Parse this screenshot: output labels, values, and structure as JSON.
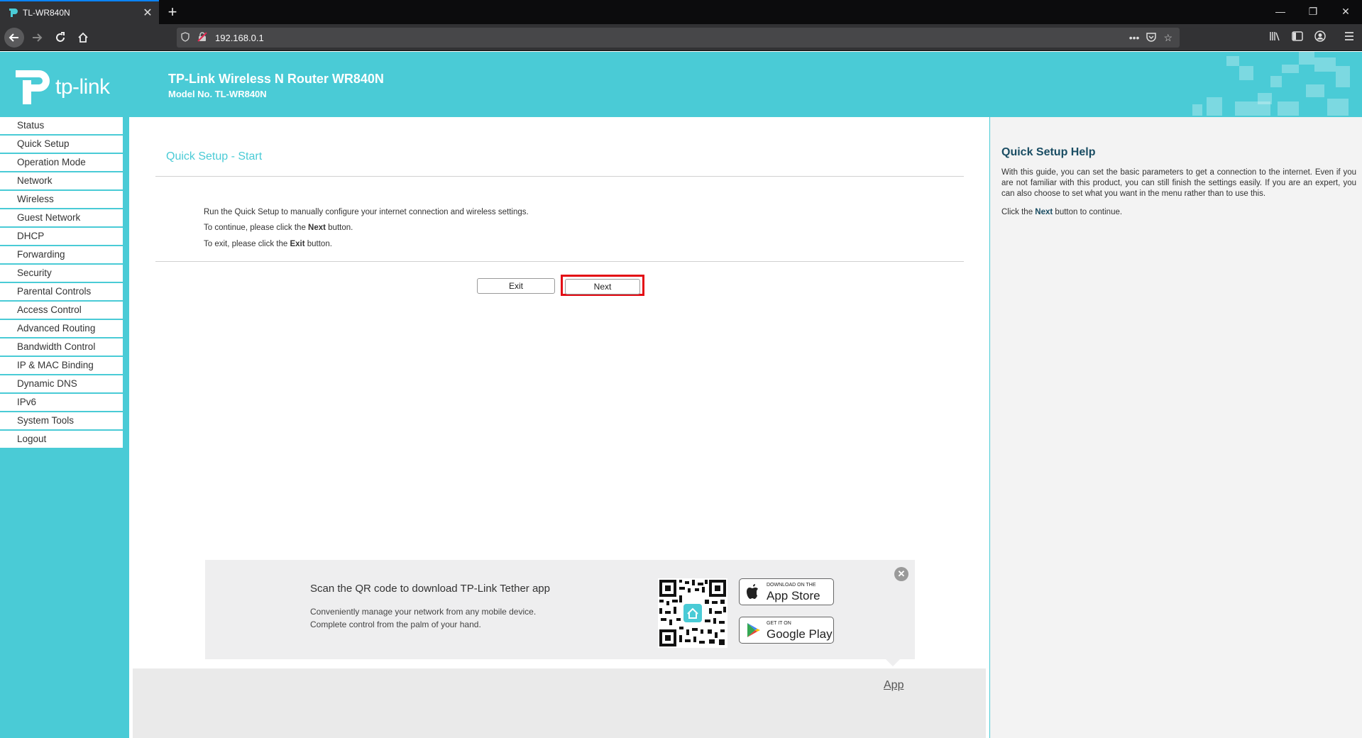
{
  "browser": {
    "tab_title": "TL-WR840N",
    "tab_close": "✕",
    "new_tab": "+",
    "url": "192.168.0.1",
    "window_controls": [
      "—",
      "❐",
      "✕"
    ]
  },
  "header": {
    "logo_text": "tp-link",
    "title": "TP-Link Wireless N Router WR840N",
    "model": "Model No. TL-WR840N"
  },
  "sidebar": {
    "items": [
      "Status",
      "Quick Setup",
      "Operation Mode",
      "Network",
      "Wireless",
      "Guest Network",
      "DHCP",
      "Forwarding",
      "Security",
      "Parental Controls",
      "Access Control",
      "Advanced Routing",
      "Bandwidth Control",
      "IP & MAC Binding",
      "Dynamic DNS",
      "IPv6",
      "System Tools",
      "Logout"
    ]
  },
  "main": {
    "title": "Quick Setup - Start",
    "line1": "Run the Quick Setup to manually configure your internet connection and wireless settings.",
    "line2_pre": "To continue, please click the ",
    "line2_bold": "Next",
    "line2_post": " button.",
    "line3_pre": "To exit, please click the ",
    "line3_bold": "Exit",
    "line3_post": " button.",
    "exit_label": "Exit",
    "next_label": "Next"
  },
  "app_banner": {
    "heading": "Scan the QR code to download TP-Link Tether app",
    "sub1": "Conveniently manage your network from any mobile device.",
    "sub2": "Complete control from the palm of your hand.",
    "appstore_small": "DOWNLOAD ON THE",
    "appstore_big": "App Store",
    "play_small": "GET IT ON",
    "play_big": "Google Play",
    "close": "✕",
    "app_link": "App"
  },
  "help": {
    "title": "Quick Setup Help",
    "para": "With this guide, you can set the basic parameters to get a connection to the internet. Even if you are not familiar with this product, you can still finish the settings easily. If you are an expert, you can also choose to set what you want in the menu rather than to use this.",
    "click_pre": "Click the ",
    "click_bold": "Next",
    "click_post": " button to continue."
  },
  "colors": {
    "brand": "#4acbd6",
    "highlight": "#e30c15",
    "help_title": "#1a4d63"
  }
}
